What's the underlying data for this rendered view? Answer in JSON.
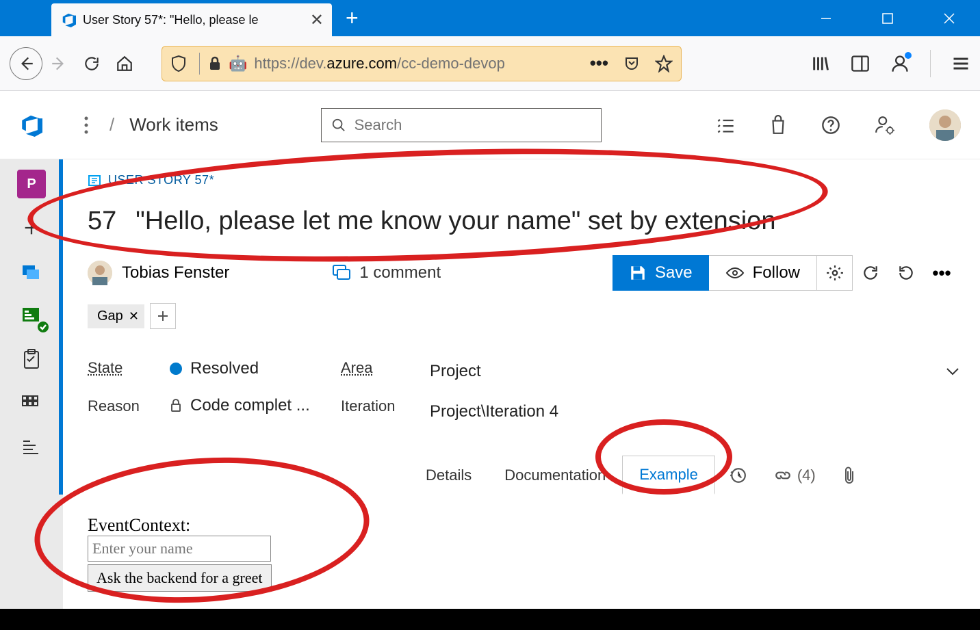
{
  "browser": {
    "tab_title": "User Story 57*: \"Hello, please le",
    "url_prefix": "https://dev.",
    "url_host": "azure.com",
    "url_suffix": "/cc-demo-devop"
  },
  "header": {
    "breadcrumb": "Work items",
    "search_placeholder": "Search"
  },
  "workitem": {
    "type_label": "USER STORY 57*",
    "id": "57",
    "title": "\"Hello, please let me know your name\" set by extension",
    "author": "Tobias Fenster",
    "comments_label": "1 comment",
    "save_label": "Save",
    "follow_label": "Follow",
    "tag": "Gap",
    "state_label": "State",
    "state_value": "Resolved",
    "reason_label": "Reason",
    "reason_value": "Code complet ...",
    "area_label": "Area",
    "area_value": "Project",
    "iteration_label": "Iteration",
    "iteration_value": "Project\\Iteration 4",
    "tabs": {
      "details": "Details",
      "docs": "Documentation",
      "example": "Example"
    },
    "links_count": "(4)"
  },
  "extension": {
    "label": "EventContext:",
    "placeholder": "Enter your name",
    "button": "Ask the backend for a greet"
  }
}
